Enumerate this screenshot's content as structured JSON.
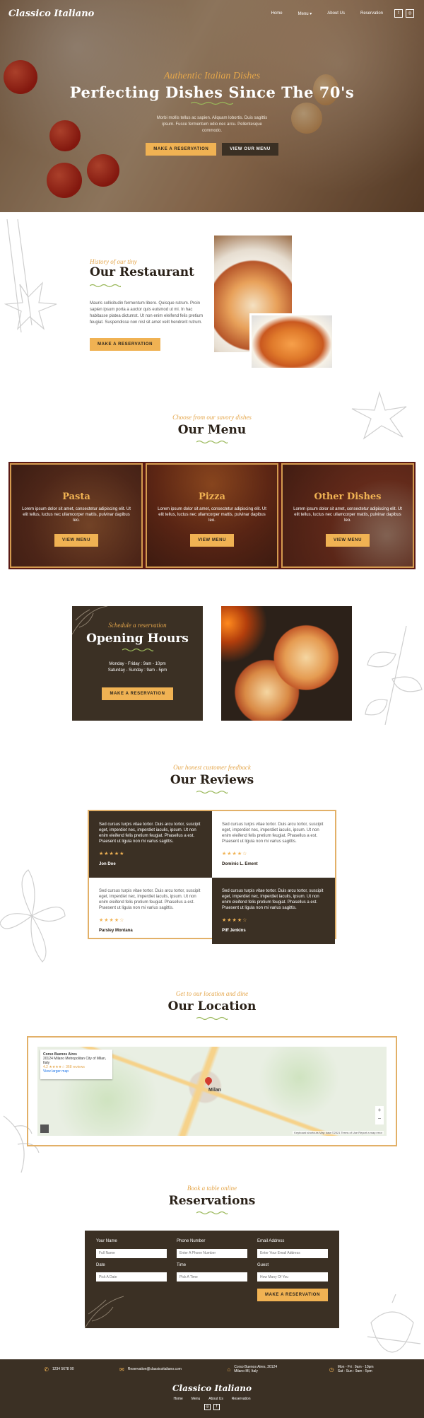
{
  "brand": {
    "logo": "Classico Italiano",
    "accent": "#f0b253",
    "dark": "#3b3024"
  },
  "nav": {
    "items": [
      "Home",
      "Menu ▾",
      "About Us",
      "Reservation"
    ],
    "social": [
      "f",
      "◎"
    ]
  },
  "hero": {
    "subtitle": "Authentic Italian Dishes",
    "title": "Perfecting Dishes Since The 70's",
    "body": "Morbi mollis tellus ac sapien. Aliquam lobortis. Duis sagittis ipsum. Fusce fermentum odio nec arcu. Pellentesque commodo.",
    "btn_reserve": "Make a Reservation",
    "btn_menu": "View our Menu"
  },
  "restaurant": {
    "script": "History of our tiny",
    "title": "Our Restaurant",
    "body": "Mauris sollicitudin fermentum libero. Quisque rutrum. Proin sapien ipsum porta a auctor quis euismod ut mi. In hac habitasse platea dictumst. Ut non enim eleifend felis pretium feugiat. Suspendisse non nisl sit amet velit hendrerit rutrum.",
    "btn": "Make a Reservation"
  },
  "menu": {
    "script": "Choose from our savory dishes",
    "title": "Our Menu",
    "cards": [
      {
        "title": "Pasta",
        "body": "Lorem ipsum dolor sit amet, consectetur adipiscing elit. Ut elit tellus, luctus nec ullamcorper mattis, pulvinar dapibus leo.",
        "btn": "View Menu"
      },
      {
        "title": "Pizza",
        "body": "Lorem ipsum dolor sit amet, consectetur adipiscing elit. Ut elit tellus, luctus nec ullamcorper mattis, pulvinar dapibus leo.",
        "btn": "View Menu"
      },
      {
        "title": "Other Dishes",
        "body": "Lorem ipsum dolor sit amet, consectetur adipiscing elit. Ut elit tellus, luctus nec ullamcorper mattis, pulvinar dapibus leo.",
        "btn": "View Menu"
      }
    ]
  },
  "hours": {
    "script": "Schedule a reservation",
    "title": "Opening Hours",
    "line1": "Monday - Friday : 9am - 10pm",
    "line2": "Saturday - Sunday : 9am - 5pm",
    "btn": "Make a Reservation"
  },
  "reviews": {
    "script": "Our honest customer feedback",
    "title": "Our Reviews",
    "items": [
      {
        "text": "Sed cursus turpis vitae tortor. Duis arcu tortor, suscipit eget, imperdiet nec, imperdiet iaculis, ipsum. Ut non enim eleifend felis pretium feugiat. Phasellus a est. Praesent ut ligula non mi varius sagittis.",
        "stars": "★★★★★",
        "name": "Jon Doe"
      },
      {
        "text": "Sed cursus turpis vitae tortor. Duis arcu tortor, suscipit eget, imperdiet nec, imperdiet iaculis, ipsum. Ut non enim eleifend felis pretium feugiat. Phasellus a est. Praesent ut ligula non mi varius sagittis.",
        "stars": "★★★★☆",
        "name": "Dominic L. Ement"
      },
      {
        "text": "Sed cursus turpis vitae tortor. Duis arcu tortor, suscipit eget, imperdiet nec, imperdiet iaculis, ipsum. Ut non enim eleifend felis pretium feugiat. Phasellus a est. Praesent ut ligula non mi varius sagittis.",
        "stars": "★★★★☆",
        "name": "Parsley Montana"
      },
      {
        "text": "Sed cursus turpis vitae tortor. Duis arcu tortor, suscipit eget, imperdiet nec, imperdiet iaculis, ipsum. Ut non enim eleifend felis pretium feugiat. Phasellus a est. Praesent ut ligula non mi varius sagittis.",
        "stars": "★★★★☆",
        "name": "Piff Jenkins"
      }
    ]
  },
  "location": {
    "script": "Get to our location and dine",
    "title": "Our Location",
    "map_name": "Corso Buenos Aires",
    "map_addr": "20124 Milano Metropolitan City of Milan, Italy",
    "map_rating": "4.2 ★★★★☆ 368 reviews",
    "map_link": "View larger map",
    "map_city": "Milan",
    "map_credit": "Keyboard shortcuts  Map data ©2021  Terms of Use  Report a map error"
  },
  "reservations": {
    "script": "Book a table online",
    "title": "Reservations",
    "fields": {
      "name": {
        "label": "Your Name",
        "placeholder": "Full Name"
      },
      "phone": {
        "label": "Phone Number",
        "placeholder": "Enter A Phone Number"
      },
      "email": {
        "label": "Email Address",
        "placeholder": "Enter Your Email Address"
      },
      "date": {
        "label": "Date",
        "placeholder": "Pick A Date"
      },
      "time": {
        "label": "Time",
        "placeholder": "Pick A Time"
      },
      "guest": {
        "label": "Guest",
        "placeholder": "How Many Of You"
      }
    },
    "btn": "Make a Reservation"
  },
  "footer": {
    "phone": "1234 5678 90",
    "email": "Reservation@classicoitaliano.com",
    "address": "Corso Buenos Aires, 20124 Milano MI, Italy",
    "hours": "Mon - Fri : 9am - 10pm\nSat - Sun : 9am - 5pm",
    "logo": "Classico Italiano",
    "links": [
      "Home",
      "Menu",
      "About Us",
      "Reservation"
    ],
    "social": [
      "◎",
      "f"
    ]
  }
}
